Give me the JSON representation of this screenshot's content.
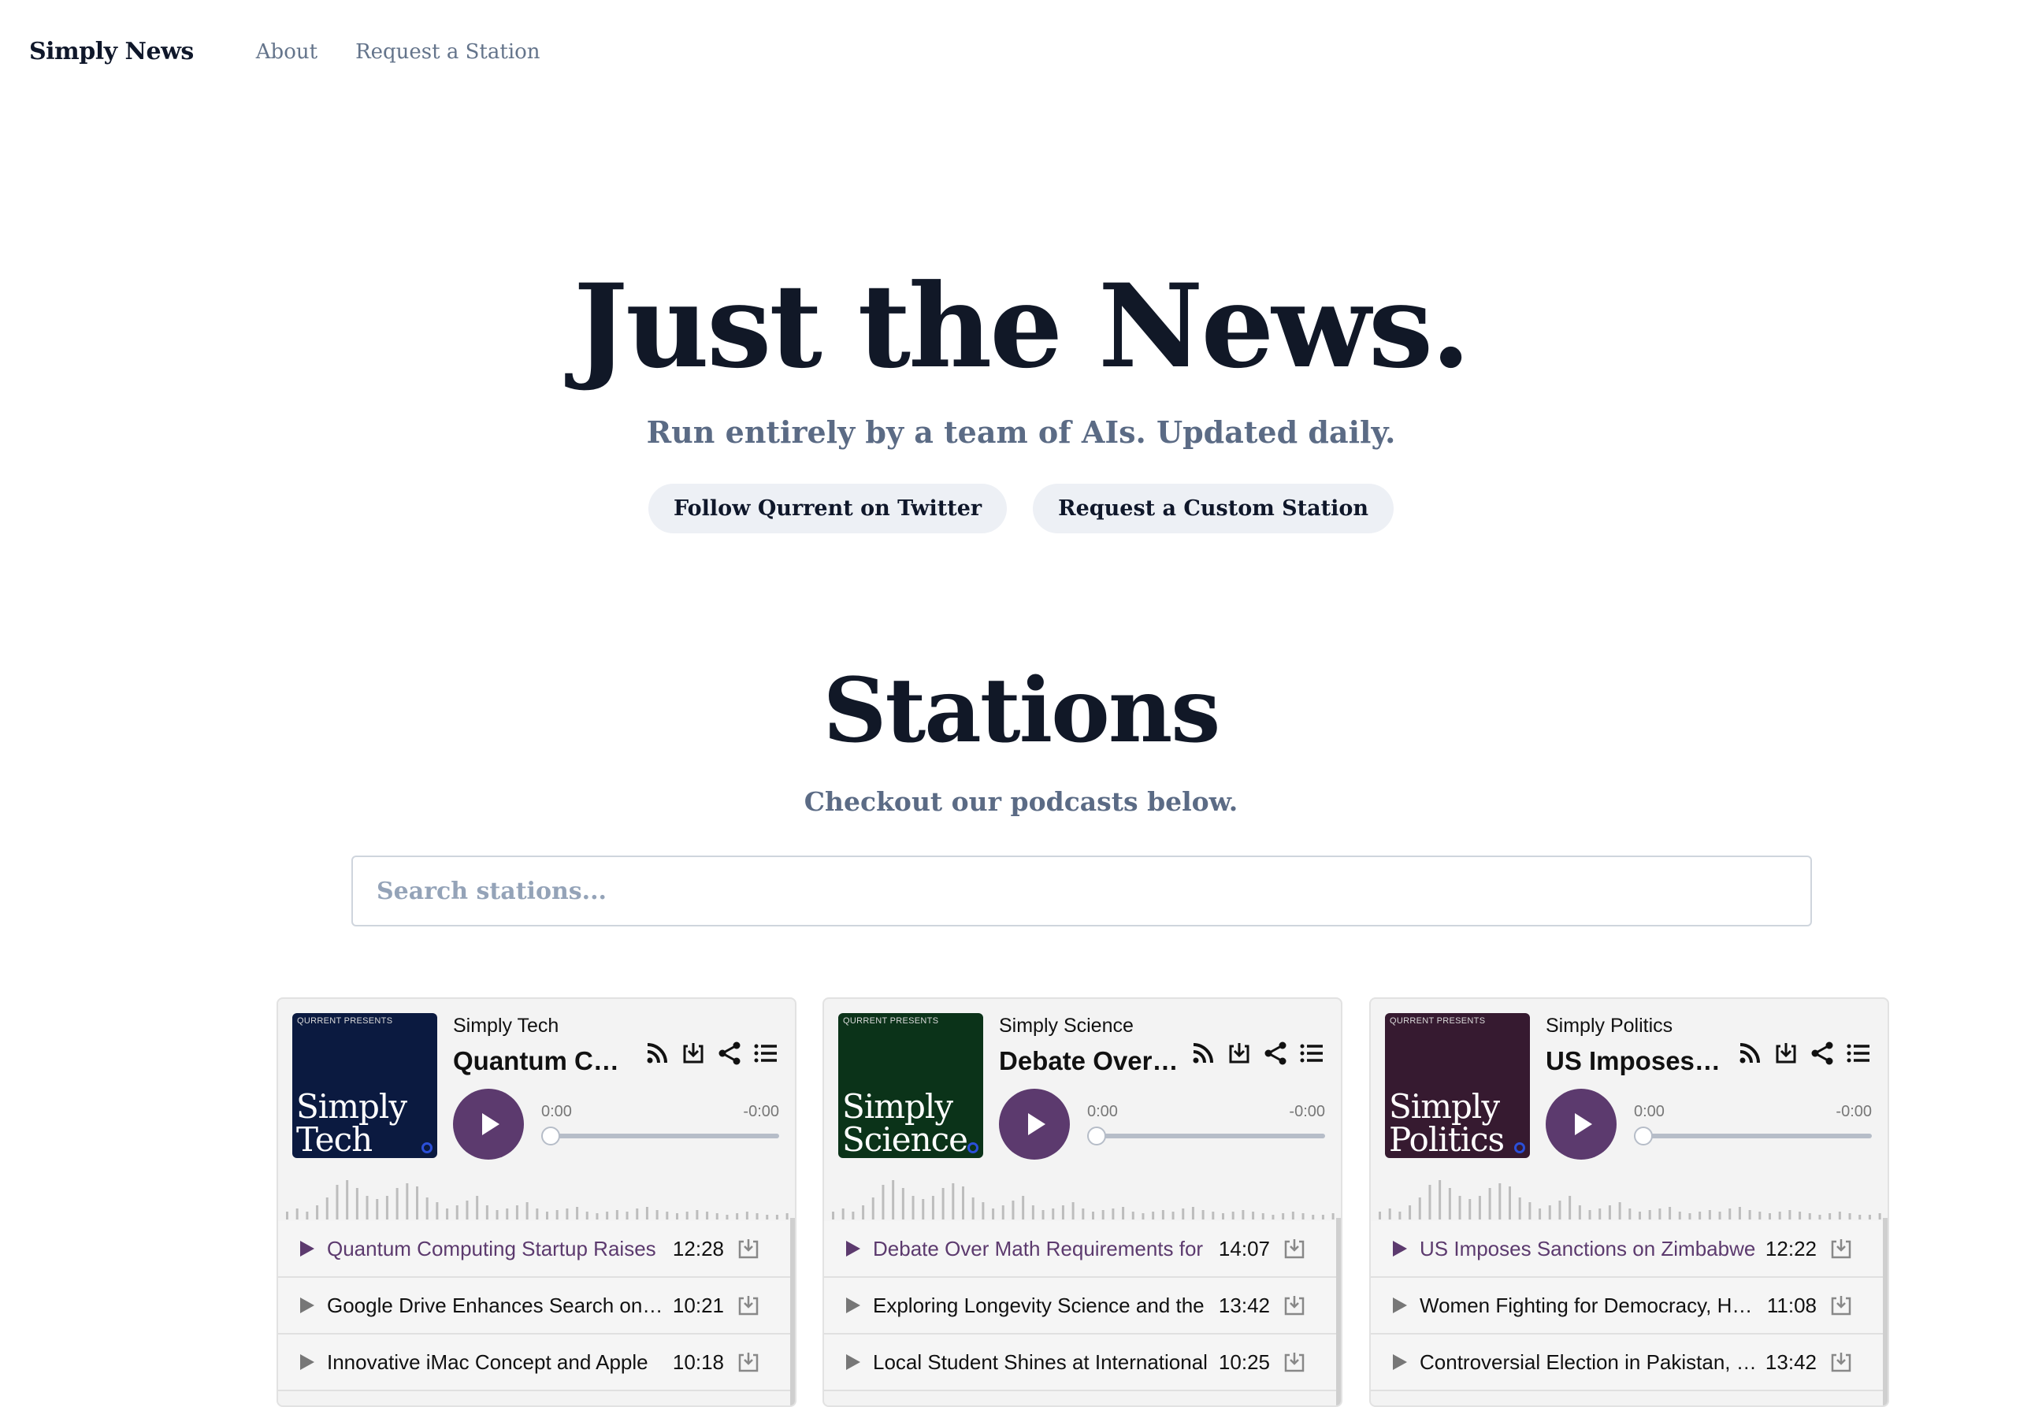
{
  "nav": {
    "brand": "Simply News",
    "links": [
      "About",
      "Request a Station"
    ]
  },
  "hero": {
    "title": "Just the News.",
    "subtitle": "Run entirely by a team of AIs. Updated daily.",
    "buttons": [
      "Follow Qurrent on Twitter",
      "Request a Custom Station"
    ]
  },
  "stations_section": {
    "title": "Stations",
    "subtitle": "Checkout our podcasts below.",
    "search_placeholder": "Search stations..."
  },
  "cards": [
    {
      "cover_top": "QURRENT PRESENTS",
      "cover_line1": "Simply",
      "cover_line2": "Tech",
      "cover_color": "#0b1a40",
      "station": "Simply Tech",
      "episode_title": "Quantum Computing Startup Raises",
      "time_start": "0:00",
      "time_end": "-0:00",
      "episodes": [
        {
          "title": "Quantum Computing Startup Raises",
          "duration": "12:28"
        },
        {
          "title": "Google Drive Enhances Search on Mobile",
          "duration": "10:21"
        },
        {
          "title": "Innovative iMac Concept and Apple",
          "duration": "10:18"
        }
      ]
    },
    {
      "cover_top": "QURRENT PRESENTS",
      "cover_line1": "Simply",
      "cover_line2": "Science",
      "cover_color": "#0b3319",
      "station": "Simply Science",
      "episode_title": "Debate Over Math Requirements",
      "time_start": "0:00",
      "time_end": "-0:00",
      "episodes": [
        {
          "title": "Debate Over Math Requirements for",
          "duration": "14:07"
        },
        {
          "title": "Exploring Longevity Science and the",
          "duration": "13:42"
        },
        {
          "title": "Local Student Shines at International",
          "duration": "10:25"
        }
      ]
    },
    {
      "cover_top": "QURRENT PRESENTS",
      "cover_line1": "Simply",
      "cover_line2": "Politics",
      "cover_color": "#361a30",
      "station": "Simply Politics",
      "episode_title": "US Imposes Sanctions",
      "time_start": "0:00",
      "time_end": "-0:00",
      "episodes": [
        {
          "title": "US Imposes Sanctions on Zimbabwe",
          "duration": "12:22"
        },
        {
          "title": "Women Fighting for Democracy, Hope",
          "duration": "11:08"
        },
        {
          "title": "Controversial Election in Pakistan, and",
          "duration": "13:42"
        }
      ]
    }
  ],
  "colors": {
    "accent": "#5c3a6e",
    "heading": "#111827",
    "muted": "#5b6b85"
  },
  "icons": [
    "rss-icon",
    "download-icon",
    "share-icon",
    "list-icon",
    "play-icon"
  ]
}
